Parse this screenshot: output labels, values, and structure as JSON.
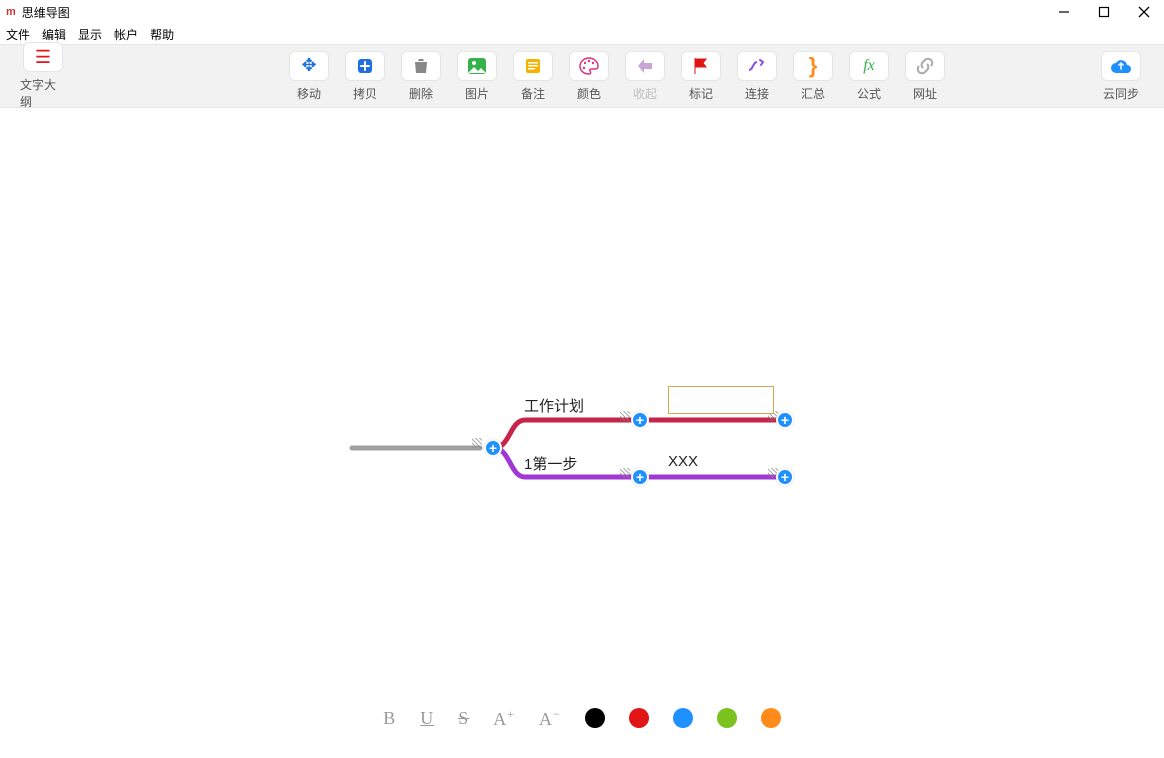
{
  "window": {
    "title": "思维导图"
  },
  "menus": [
    "文件",
    "编辑",
    "显示",
    "帐户",
    "帮助"
  ],
  "toolbar": {
    "outline": "文字大纲",
    "move": "移动",
    "copy": "拷贝",
    "delete": "删除",
    "image": "图片",
    "note": "备注",
    "color": "颜色",
    "collapse": "收起",
    "mark": "标记",
    "connect": "连接",
    "summary": "汇总",
    "formula": "公式",
    "url": "网址",
    "cloudsync": "云同步"
  },
  "nodes": {
    "root": "",
    "n1": "工作计划",
    "n2": "1第一步",
    "n3": "",
    "n4": "XXX"
  },
  "bottombar": {
    "bold": "B",
    "underline": "U",
    "strike": "S",
    "inc": "A",
    "dec": "A"
  },
  "colors": {
    "black": "#000000",
    "red": "#e11515",
    "blue": "#1e90ff",
    "green": "#7cc21e",
    "orange": "#ff8c1a",
    "purple": "#a038d6",
    "crimson": "#c6254a"
  }
}
